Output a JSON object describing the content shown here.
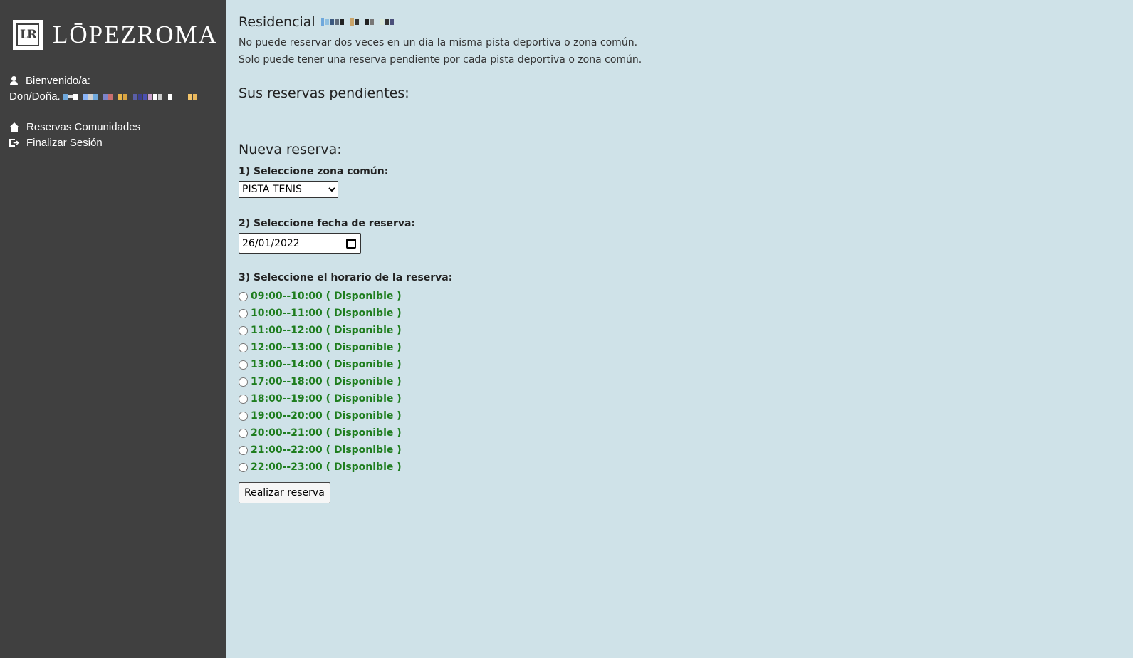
{
  "sidebar": {
    "logo_mark": "LR",
    "logo_text": "LŌPEZROMA",
    "welcome_label": "Bienvenido/a:",
    "salutation": "Don/Doña.",
    "nav": [
      {
        "label": "Reservas Comunidades",
        "icon": "home-icon"
      },
      {
        "label": "Finalizar Sesión",
        "icon": "sign-out-icon"
      }
    ]
  },
  "main": {
    "title": "Residencial",
    "notes": [
      "No puede reservar dos veces en un dia la misma pista deportiva o zona común.",
      "Solo puede tener una reserva pendiente por cada pista deportiva o zona común."
    ],
    "pending_title": "Sus reservas pendientes:",
    "new_title": "Nueva reserva:",
    "step1_label": "1) Seleccione zona común:",
    "zone_selected": "PISTA TENIS",
    "step2_label": "2) Seleccione fecha de reserva:",
    "date_value": "26/01/2022",
    "step3_label": "3) Seleccione el horario de la reserva:",
    "slots": [
      "09:00--10:00 ( Disponible )",
      "10:00--11:00 ( Disponible )",
      "11:00--12:00 ( Disponible )",
      "12:00--13:00 ( Disponible )",
      "13:00--14:00 ( Disponible )",
      "17:00--18:00 ( Disponible )",
      "18:00--19:00 ( Disponible )",
      "19:00--20:00 ( Disponible )",
      "20:00--21:00 ( Disponible )",
      "21:00--22:00 ( Disponible )",
      "22:00--23:00 ( Disponible )"
    ],
    "submit_label": "Realizar reserva"
  },
  "colors": {
    "sidebar_bg": "#404040",
    "page_bg": "#cfe2e8",
    "available_green": "#1e7d1e"
  }
}
